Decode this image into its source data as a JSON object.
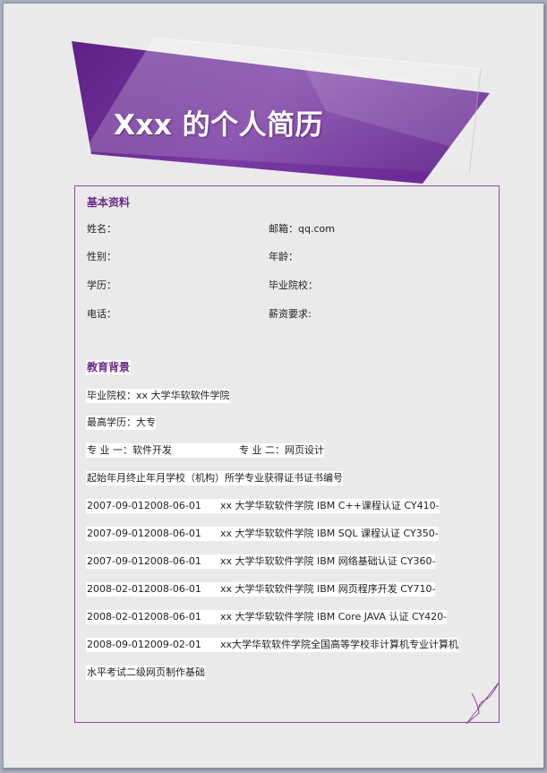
{
  "header": {
    "title": "Xxx 的个人简历"
  },
  "basic": {
    "title": "基本资料",
    "fields": {
      "name": "姓名：",
      "email": "邮箱：qq.com",
      "gender": "性别：",
      "age": "年龄：",
      "education": "学历：",
      "school": "毕业院校：",
      "phone": "电话：",
      "salary": "薪资要求:"
    }
  },
  "edu": {
    "title": "教育背景",
    "school": "毕业院校：xx 大学华软软件学院",
    "degree": "最高学历：大专",
    "major1": "专  业  一：软件开发",
    "major2": "专  业  二：网页设计",
    "header": "起始年月终止年月学校（机构）所学专业获得证书证书编号",
    "entries": [
      {
        "dates": "2007-09-012008-06-01",
        "detail": "xx 大学华软软件学院 IBM C++课程认证 CY410-"
      },
      {
        "dates": "2007-09-012008-06-01",
        "detail": "xx 大学华软软件学院 IBM SQL 课程认证 CY350-"
      },
      {
        "dates": "2007-09-012008-06-01",
        "detail": "xx 大学华软软件学院 IBM  网络基础认证 CY360-"
      },
      {
        "dates": "2008-02-012008-06-01",
        "detail": "xx 大学华软软件学院 IBM  网页程序开发 CY710-"
      },
      {
        "dates": "2008-02-012008-06-01",
        "detail": "xx 大学华软软件学院 IBM Core JAVA 认证 CY420-"
      },
      {
        "dates": "2008-09-012009-02-01",
        "detail": "xx大学华软软件学院全国高等学校非计算机专业计算机"
      }
    ],
    "footer": "水平考试二级网页制作基础"
  }
}
